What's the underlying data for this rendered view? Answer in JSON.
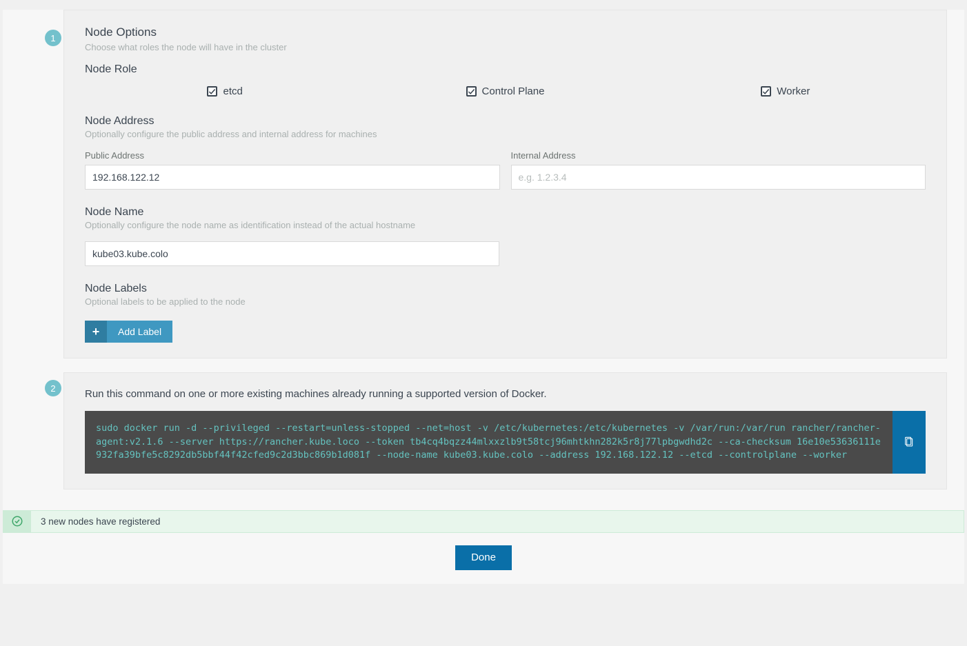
{
  "step1": {
    "badge": "1",
    "title": "Node Options",
    "subtitle": "Choose what roles the node will have in the cluster",
    "role": {
      "heading": "Node Role",
      "items": [
        {
          "label": "etcd",
          "checked": true
        },
        {
          "label": "Control Plane",
          "checked": true
        },
        {
          "label": "Worker",
          "checked": true
        }
      ]
    },
    "address": {
      "heading": "Node Address",
      "subtitle": "Optionally configure the public address and internal address for machines",
      "public": {
        "label": "Public Address",
        "value": "192.168.122.12"
      },
      "internal": {
        "label": "Internal Address",
        "placeholder": "e.g. 1.2.3.4",
        "value": ""
      }
    },
    "name": {
      "heading": "Node Name",
      "subtitle": "Optionally configure the node name as identification instead of the actual hostname",
      "value": "kube03.kube.colo"
    },
    "labels": {
      "heading": "Node Labels",
      "subtitle": "Optional labels to be applied to the node",
      "add_button": "Add Label"
    }
  },
  "step2": {
    "badge": "2",
    "description": "Run this command on one or more existing machines already running a supported version of Docker.",
    "command": "sudo docker run -d --privileged --restart=unless-stopped --net=host -v /etc/kubernetes:/etc/kubernetes -v /var/run:/var/run rancher/rancher-agent:v2.1.6 --server https://rancher.kube.loco --token tb4cq4bqzz44mlxxzlb9t58tcj96mhtkhn282k5r8j77lpbgwdhd2c --ca-checksum 16e10e53636111e932fa39bfe5c8292db5bbf44f42cfed9c2d3bbc869b1d081f --node-name kube03.kube.colo --address 192.168.122.12 --etcd --controlplane --worker"
  },
  "banner": {
    "message": "3 new nodes have registered"
  },
  "footer": {
    "done": "Done"
  }
}
